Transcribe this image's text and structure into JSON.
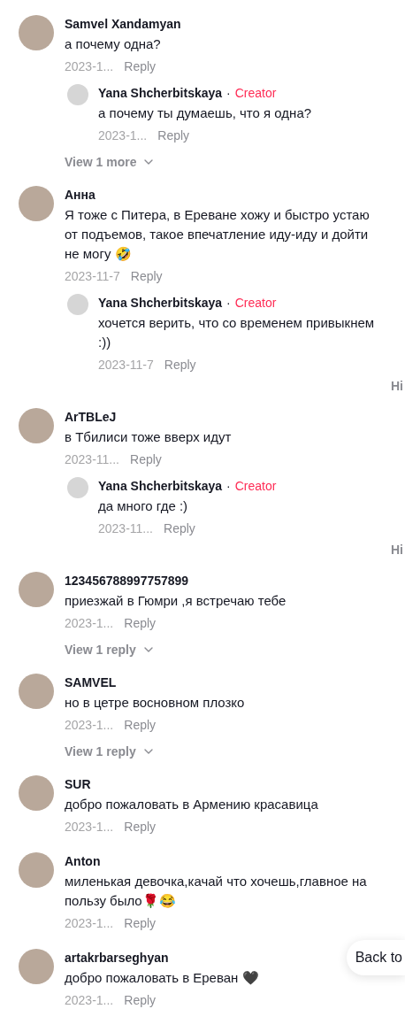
{
  "comments": [
    {
      "author": "Samvel Xandamyan",
      "text": "а почему одна?",
      "date": "2023-1...",
      "reply_label": "Reply",
      "replies": [
        {
          "author": "Yana Shcherbitskaya",
          "separator": "·",
          "badge": "Creator",
          "text": "а почему ты думаешь, что я одна?",
          "date": "2023-1...",
          "reply_label": "Reply"
        }
      ],
      "view_more": "View 1 more"
    },
    {
      "author": "Анна",
      "text": "Я тоже с Питера, в Ереване хожу и быстро устаю от подъемов, такое впечатление иду-иду и дойти не могу 🤣",
      "date": "2023-11-7",
      "reply_label": "Reply",
      "replies": [
        {
          "author": "Yana Shcherbitskaya",
          "separator": "·",
          "badge": "Creator",
          "text": "хочется верить, что со временем привыкнем :))",
          "date": "2023-11-7",
          "reply_label": "Reply"
        }
      ],
      "hide": "Hi"
    },
    {
      "author": "ArTBLeJ",
      "text": "в Тбилиси тоже вверх идут",
      "date": "2023-11...",
      "reply_label": "Reply",
      "replies": [
        {
          "author": "Yana Shcherbitskaya",
          "separator": "·",
          "badge": "Creator",
          "text": "да много где :)",
          "date": "2023-11...",
          "reply_label": "Reply"
        }
      ],
      "hide": "Hi"
    },
    {
      "author": "123456788997757899",
      "text": "приезжай в Гюмри ,я встречаю тебе",
      "date": "2023-1...",
      "reply_label": "Reply",
      "view_more": "View 1 reply"
    },
    {
      "author": "SAMVEL",
      "text": "но в цетре восновном плозко",
      "date": "2023-1...",
      "reply_label": "Reply",
      "view_more": "View 1 reply"
    },
    {
      "author": "SUR",
      "text": "добро пожаловать в Армению красавица",
      "date": "2023-1...",
      "reply_label": "Reply"
    },
    {
      "author": "Anton",
      "text": "миленькая девочка,качай что хочешь,главное на пользу было🌹😂",
      "date": "2023-1...",
      "reply_label": "Reply"
    },
    {
      "author": "artakrbarseghyan",
      "text": "добро пожаловать в Ереван 🖤",
      "date": "2023-1...",
      "reply_label": "Reply"
    }
  ],
  "back_to_top": "Back to"
}
